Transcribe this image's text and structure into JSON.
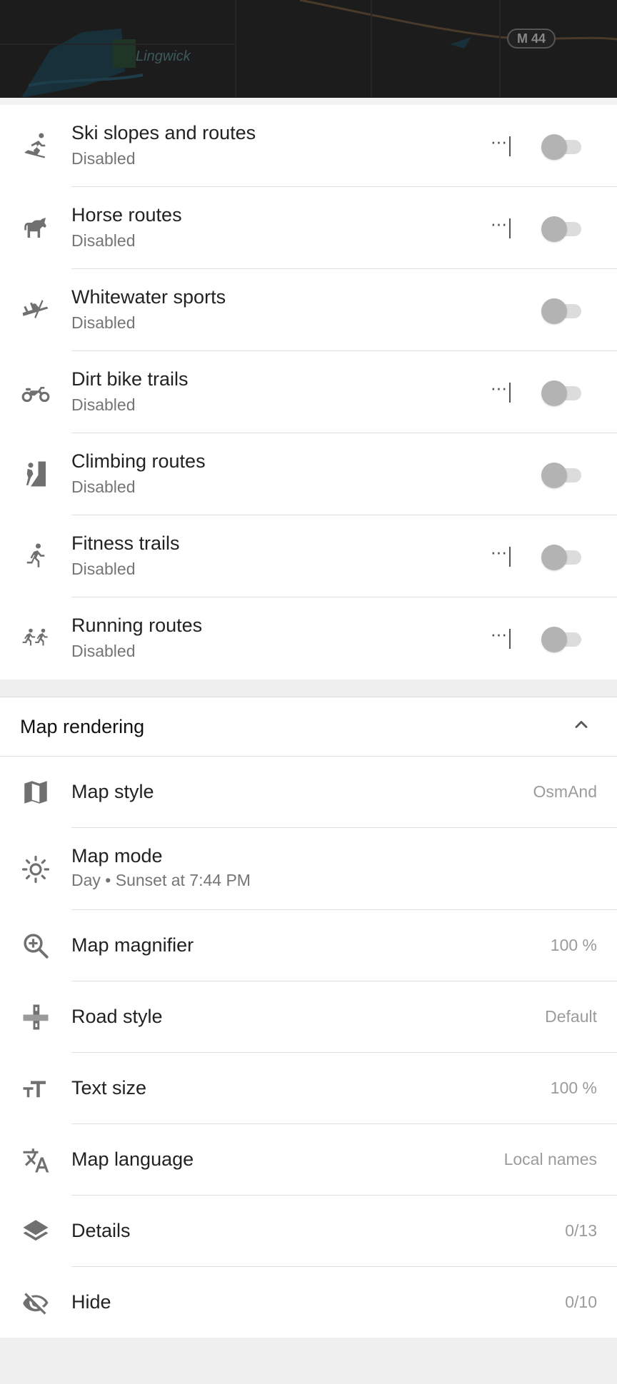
{
  "map": {
    "route_badge": "M 44",
    "town_label": "Lingwick"
  },
  "layers": [
    {
      "icon": "skier-icon",
      "title": "Ski slopes and routes",
      "status": "Disabled",
      "has_menu": true
    },
    {
      "icon": "horse-icon",
      "title": "Horse routes",
      "status": "Disabled",
      "has_menu": true
    },
    {
      "icon": "kayak-icon",
      "title": "Whitewater sports",
      "status": "Disabled",
      "has_menu": false
    },
    {
      "icon": "dirt-bike-icon",
      "title": "Dirt bike trails",
      "status": "Disabled",
      "has_menu": true
    },
    {
      "icon": "climbing-icon",
      "title": "Climbing routes",
      "status": "Disabled",
      "has_menu": false
    },
    {
      "icon": "runner-icon",
      "title": "Fitness trails",
      "status": "Disabled",
      "has_menu": true
    },
    {
      "icon": "running-group-icon",
      "title": "Running routes",
      "status": "Disabled",
      "has_menu": true
    }
  ],
  "more_glyph": "···",
  "render_section": {
    "title": "Map rendering",
    "items": [
      {
        "icon": "map-icon",
        "title": "Map style",
        "value": "OsmAnd"
      },
      {
        "icon": "sun-icon",
        "title": "Map mode",
        "sub": "Day • Sunset at 7:44 PM"
      },
      {
        "icon": "zoom-in-icon",
        "title": "Map magnifier",
        "value": "100 %"
      },
      {
        "icon": "road-icon",
        "title": "Road style",
        "value": "Default"
      },
      {
        "icon": "text-size-icon",
        "title": "Text size",
        "value": "100 %"
      },
      {
        "icon": "translate-icon",
        "title": "Map language",
        "value": "Local names"
      },
      {
        "icon": "layers-icon",
        "title": "Details",
        "value": "0/13"
      },
      {
        "icon": "eye-off-icon",
        "title": "Hide",
        "value": "0/10"
      }
    ]
  }
}
